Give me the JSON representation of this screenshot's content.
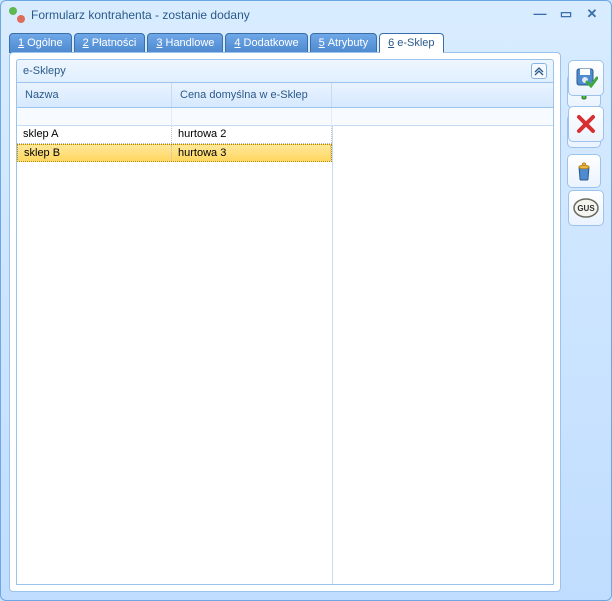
{
  "window": {
    "title": "Formularz kontrahenta - zostanie dodany"
  },
  "tabs": [
    {
      "num": "1",
      "label": "Ogólne"
    },
    {
      "num": "2",
      "label": "Płatności"
    },
    {
      "num": "3",
      "label": "Handlowe"
    },
    {
      "num": "4",
      "label": "Dodatkowe"
    },
    {
      "num": "5",
      "label": "Atrybuty"
    },
    {
      "num": "6",
      "label": "e-Sklep"
    }
  ],
  "activeTab": 5,
  "group": {
    "title": "e-Sklepy"
  },
  "grid": {
    "columns": [
      {
        "label": "Nazwa"
      },
      {
        "label": "Cena domyślna w e-Sklep"
      }
    ],
    "rows": [
      {
        "name": "sklep A",
        "price": "hurtowa 2",
        "selected": false
      },
      {
        "name": "sklep B",
        "price": "hurtowa 3",
        "selected": true
      }
    ]
  },
  "icons": {
    "add": "plus",
    "search": "magnifier",
    "delete": "trash",
    "save": "disk-check",
    "cancel": "x-red",
    "gus": "GUS"
  }
}
